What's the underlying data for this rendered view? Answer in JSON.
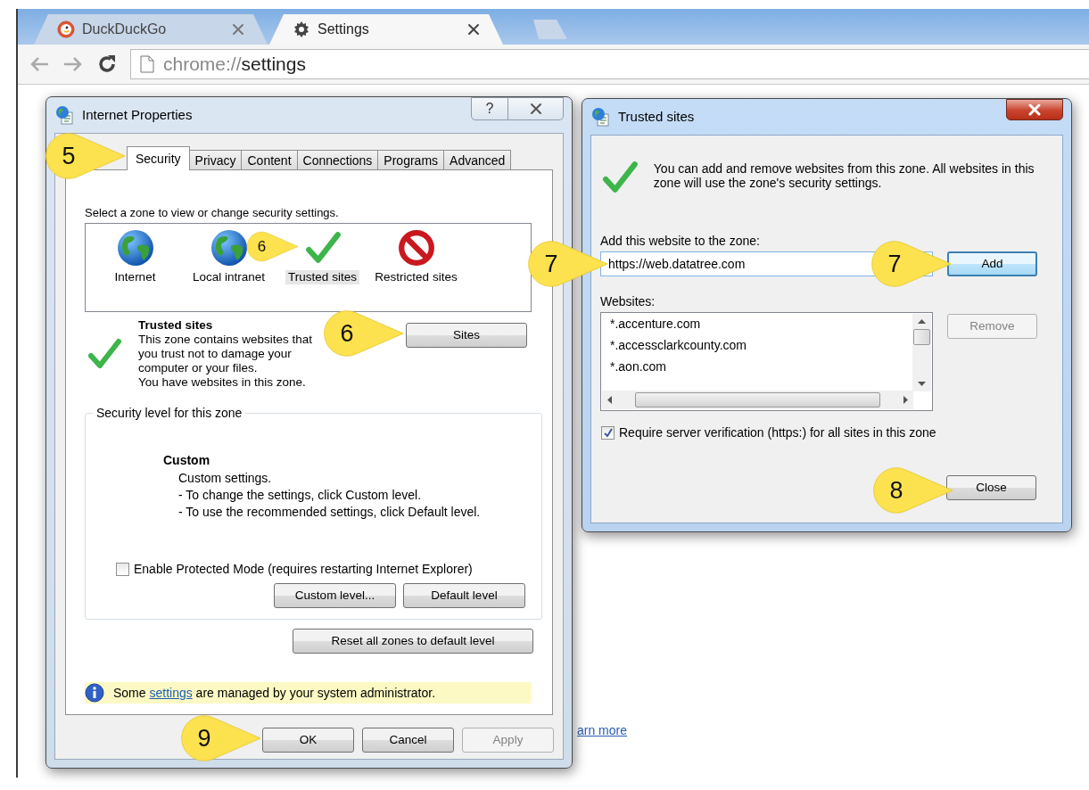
{
  "browser": {
    "tabs": [
      {
        "kind": "site",
        "title": "DuckDuckGo",
        "selected": false
      },
      {
        "kind": "settings",
        "title": "Settings",
        "selected": true
      }
    ],
    "address_scheme": "chrome://",
    "address_path": "settings"
  },
  "page": {
    "link": "arn more"
  },
  "internet_properties": {
    "title": "Internet Properties",
    "help_button": "?",
    "tabs": [
      {
        "label": "Security",
        "selected": true
      },
      {
        "label": "Privacy",
        "selected": false
      },
      {
        "label": "Content",
        "selected": false
      },
      {
        "label": "Connections",
        "selected": false
      },
      {
        "label": "Programs",
        "selected": false
      },
      {
        "label": "Advanced",
        "selected": false
      }
    ],
    "zone_prompt": "Select a zone to view or change security settings.",
    "zones": [
      {
        "kind": "globe",
        "label": "Internet",
        "selected": false
      },
      {
        "kind": "globe",
        "label": "Local intranet",
        "selected": false
      },
      {
        "kind": "check",
        "label": "Trusted sites",
        "selected": true
      },
      {
        "kind": "forbidden",
        "label": "Restricted sites",
        "selected": false
      }
    ],
    "zone_title": "Trusted sites",
    "zone_description": "This zone contains websites that you trust not to damage your computer or your files.",
    "zone_note": "You have websites in this zone.",
    "sites_button": "Sites",
    "level_group": "Security level for this zone",
    "level_name": "Custom",
    "level_lines": [
      "Custom settings.",
      "- To change the settings, click Custom level.",
      "- To use the recommended settings, click Default level."
    ],
    "protected_mode": {
      "label": "Enable Protected Mode (requires restarting Internet Explorer)",
      "checked": false
    },
    "level_buttons": [
      "Custom level...",
      "Default level"
    ],
    "reset_button": "Reset all zones to default level",
    "info_before": "Some ",
    "info_link": "settings",
    "info_after": " are managed by your system administrator.",
    "buttons": [
      {
        "label": "OK",
        "disabled": false
      },
      {
        "label": "Cancel",
        "disabled": false
      },
      {
        "label": "Apply",
        "disabled": true
      }
    ]
  },
  "trusted_sites": {
    "title": "Trusted sites",
    "intro": "You can add and remove websites from this zone. All websites in this zone will use the zone's security settings.",
    "add_label": "Add this website to the zone:",
    "add_value": "https://web.datatree.com",
    "add_button": {
      "label": "Add",
      "focused": true
    },
    "websites_label": "Websites:",
    "websites": [
      "*.accenture.com",
      "*.accessclarkcounty.com",
      "*.aon.com"
    ],
    "remove_button": {
      "label": "Remove",
      "disabled": true
    },
    "require_https": {
      "label": "Require server verification (https:) for all sites in this zone",
      "checked": true
    },
    "close_button": "Close"
  },
  "callouts": [
    "5",
    "6",
    "6",
    "7",
    "7",
    "8",
    "9"
  ]
}
